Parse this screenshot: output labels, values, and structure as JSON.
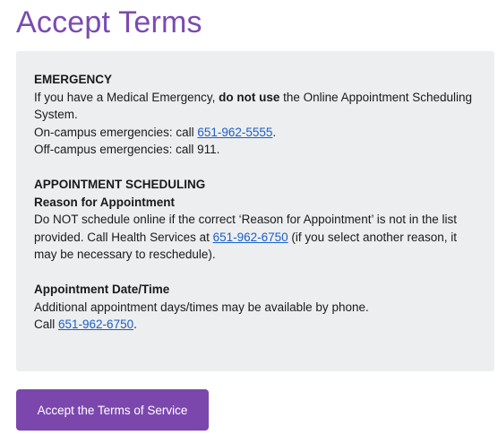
{
  "page_title": "Accept Terms",
  "emergency": {
    "heading": "EMERGENCY",
    "line1_pre": "If you have a Medical Emergency, ",
    "line1_bold": "do not use",
    "line1_post": " the Online Appointment Scheduling System.",
    "oncampus_pre": "On-campus emergencies: call ",
    "oncampus_phone": "651-962-5555",
    "oncampus_post": ".",
    "offcampus": "Off-campus emergencies: call 911."
  },
  "scheduling": {
    "heading": "APPOINTMENT SCHEDULING",
    "reason_heading": "Reason for Appointment",
    "reason_pre": "Do NOT schedule online if the correct ‘Reason for Appointment’ is not in the list provided. Call Health Services at ",
    "reason_phone": "651-962-6750",
    "reason_post": " (if you select another reason, it may be necessary to reschedule).",
    "datetime_heading": "Appointment Date/Time",
    "datetime_line": "Additional appointment days/times may be available by phone.",
    "call_pre": "Call ",
    "call_phone": "651-962-6750",
    "call_post": "."
  },
  "accept_button_label": "Accept the Terms of Service",
  "colors": {
    "accent": "#7b47ad",
    "title": "#7a4bb1",
    "link": "#1b5fc4",
    "panel_bg": "#eceef0"
  }
}
